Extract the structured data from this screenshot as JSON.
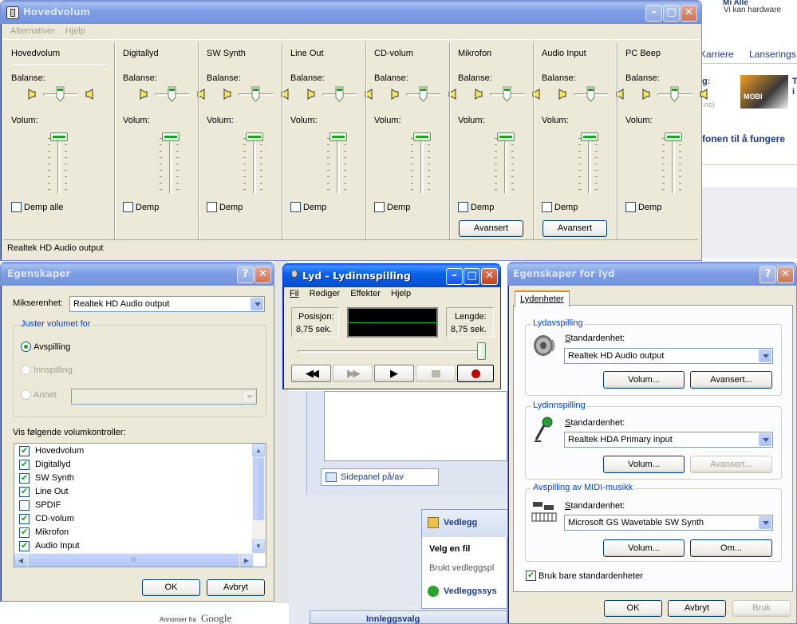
{
  "background_page": {
    "top_right_1": "Mi Alle",
    "top_right_2": "Vi kan hardware",
    "nav_1": "Karriere",
    "nav_2": "Lanserings",
    "item_label_prefix": "g:",
    "item_text": "T i",
    "item_source": "r.no)",
    "headline_fragment": "fonen til å fungere",
    "sidepanel_toggle": "Sidepanel på/av",
    "vedlegg_title": "Vedlegg",
    "velg_en_fil": "Velg en fil",
    "brukt_vedlegg": "Brukt vedleggspl",
    "vedleggssys": "Vedleggssys",
    "innleggsvalg": "Innleggsvalg",
    "ad_text": "Annonser fra",
    "ad_brand": "Google",
    "mobil_logo": "MOBI"
  },
  "mixer": {
    "title": "Hovedvolum",
    "menu": [
      "Alternativer",
      "Hjelp"
    ],
    "balance_label": "Balanse:",
    "volume_label": "Volum:",
    "status": "Realtek HD Audio output",
    "advanced_label": "Avansert",
    "channels": [
      {
        "name": "Hovedvolum",
        "mute": "Demp alle",
        "advanced": false
      },
      {
        "name": "Digitallyd",
        "mute": "Demp",
        "advanced": false
      },
      {
        "name": "SW Synth",
        "mute": "Demp",
        "advanced": false
      },
      {
        "name": "Line Out",
        "mute": "Demp",
        "advanced": false
      },
      {
        "name": "CD-volum",
        "mute": "Demp",
        "advanced": false
      },
      {
        "name": "Mikrofon",
        "mute": "Demp",
        "advanced": true
      },
      {
        "name": "Audio Input",
        "mute": "Demp",
        "advanced": true
      },
      {
        "name": "PC Beep",
        "mute": "Demp",
        "advanced": false
      }
    ]
  },
  "egenskaper": {
    "title": "Egenskaper",
    "mixer_device_label": "Mikserenhet:",
    "mixer_device_value": "Realtek HD Audio output",
    "group_title": "Juster volumet for",
    "radio_playback": "Avspilling",
    "radio_recording": "Innspilling",
    "radio_other": "Annet",
    "list_label": "Vis følgende volumkontroller:",
    "controls": [
      {
        "label": "Hovedvolum",
        "checked": true
      },
      {
        "label": "Digitallyd",
        "checked": true
      },
      {
        "label": "SW Synth",
        "checked": true
      },
      {
        "label": "Line Out",
        "checked": true
      },
      {
        "label": "SPDIF",
        "checked": false
      },
      {
        "label": "CD-volum",
        "checked": true
      },
      {
        "label": "Mikrofon",
        "checked": true
      },
      {
        "label": "Audio Input",
        "checked": true
      }
    ],
    "hscroll_grip": "III",
    "ok": "OK",
    "cancel": "Avbryt"
  },
  "recorder": {
    "title": "Lyd - Lydinnspilling",
    "menu": [
      "Fil",
      "Rediger",
      "Effekter",
      "Hjelp"
    ],
    "position_label": "Posisjon:",
    "position_value": "8,75 sek.",
    "length_label": "Lengde:",
    "length_value": "8,75 sek."
  },
  "sound_props": {
    "title": "Egenskaper for lyd",
    "tab": "Lydenheter",
    "playback_group": "Lydavspilling",
    "recording_group": "Lydinnspilling",
    "midi_group": "Avspilling av MIDI-musikk",
    "default_device_label": "Standardenhet:",
    "playback_device": "Realtek HD Audio output",
    "recording_device": "Realtek HDA Primary input",
    "midi_device": "Microsoft GS Wavetable SW Synth",
    "volume_btn": "Volum...",
    "advanced_btn": "Avansert...",
    "about_btn": "Om...",
    "default_only": "Bruk bare standardenheter",
    "ok": "OK",
    "cancel": "Avbryt",
    "apply": "Bruk"
  },
  "colors": {
    "title_active": "#0453d6",
    "title_inactive": "#7f9ee5",
    "dialog_bg": "#ece9d8",
    "check_green": "#21a121",
    "group_title_blue": "#0046d5"
  }
}
